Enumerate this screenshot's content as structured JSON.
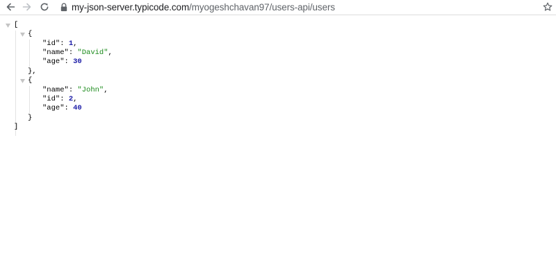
{
  "browser": {
    "url_host": "my-json-server.typicode.com",
    "url_path": "/myogeshchavan97/users-api/users"
  },
  "json": {
    "open_bracket": "[",
    "close_bracket": "]",
    "open_brace": "{",
    "close_brace_comma": "},",
    "close_brace": "}",
    "colon": ": ",
    "comma": ",",
    "items": [
      {
        "fields": [
          {
            "key": "\"id\"",
            "value": "1",
            "type": "number"
          },
          {
            "key": "\"name\"",
            "value": "\"David\"",
            "type": "string"
          },
          {
            "key": "\"age\"",
            "value": "30",
            "type": "number"
          }
        ]
      },
      {
        "fields": [
          {
            "key": "\"name\"",
            "value": "\"John\"",
            "type": "string"
          },
          {
            "key": "\"id\"",
            "value": "2",
            "type": "number"
          },
          {
            "key": "\"age\"",
            "value": "40",
            "type": "number"
          }
        ]
      }
    ]
  },
  "icons": {
    "back": "arrow-left-icon",
    "forward": "arrow-right-icon",
    "reload": "reload-icon",
    "lock": "lock-icon",
    "star": "star-icon",
    "toggle": "triangle-down-icon"
  },
  "colors": {
    "string": "#1a8a1a",
    "number": "#1a1aa6",
    "guide": "#e3e3e3"
  }
}
